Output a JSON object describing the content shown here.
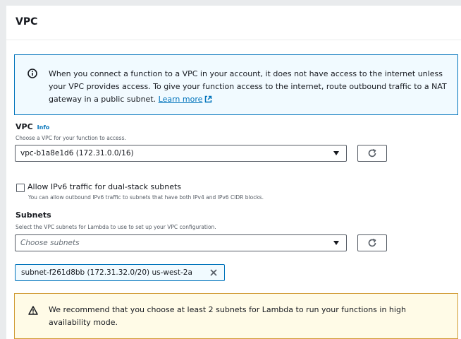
{
  "section": {
    "title": "VPC"
  },
  "info_alert": {
    "icon": "info-icon",
    "text": "When you connect a function to a VPC in your account, it does not have access to the internet unless your VPC provides access. To give your function access to the internet, route outbound traffic to a NAT gateway in a public subnet.",
    "link_label": "Learn more",
    "link_icon": "external-link-icon"
  },
  "vpc_field": {
    "label": "VPC",
    "info_label": "Info",
    "description": "Choose a VPC for your function to access.",
    "selected_value": "vpc-b1a8e1d6 (172.31.0.0/16)"
  },
  "ipv6_option": {
    "checked": false,
    "label": "Allow IPv6 traffic for dual-stack subnets",
    "description": "You can allow outbound IPv6 traffic to subnets that have both IPv4 and IPv6 CIDR blocks."
  },
  "subnets_field": {
    "label": "Subnets",
    "description": "Select the VPC subnets for Lambda to use to set up your VPC configuration.",
    "placeholder": "Choose subnets",
    "selected_tokens": [
      {
        "label": "subnet-f261d8bb (172.31.32.0/20)   us-west-2a"
      }
    ]
  },
  "warning_alert": {
    "icon": "warning-icon",
    "text": "We recommend that you choose at least 2 subnets for Lambda to run your functions in high availability mode."
  },
  "colors": {
    "accent": "#0073bb",
    "info_bg": "#f1faff",
    "warning_bg": "#fffbe7",
    "warning_border": "#d09b34"
  }
}
